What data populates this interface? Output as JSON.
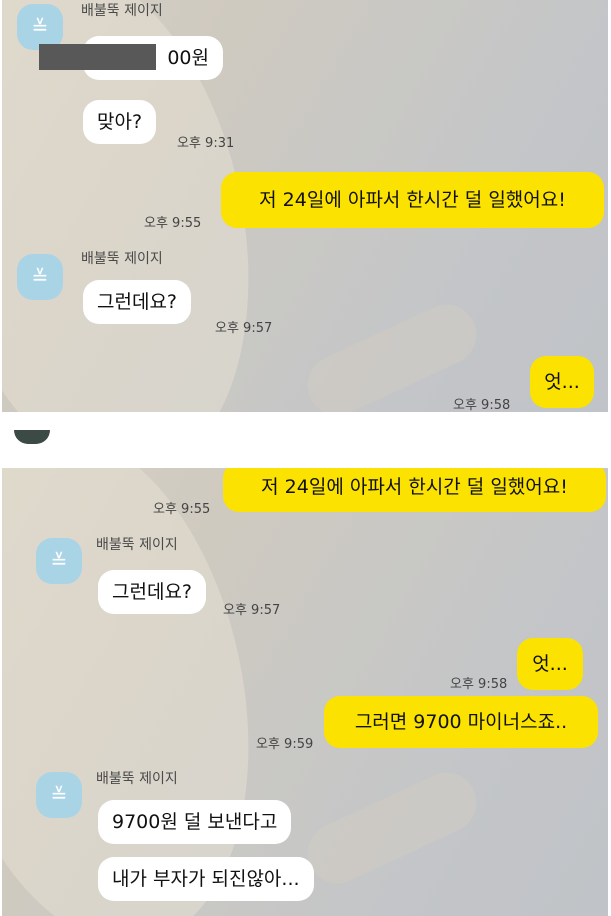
{
  "panel1": {
    "sender": "배불뚝 제이지",
    "msg_amount_suffix": "00원",
    "msg_right": "맞아?",
    "time_1": "오후 9:31",
    "my_msg_1": "저 24일에 아파서 한시간 덜 일했어요!",
    "time_2": "오후 9:55",
    "sender_2": "배불뚝 제이지",
    "msg_so": "그런데요?",
    "time_3": "오후 9:57",
    "my_msg_2": "엇...",
    "time_4": "오후 9:58"
  },
  "panel2": {
    "my_msg_1": "저 24일에 아파서 한시간 덜 일했어요!",
    "time_1": "오후 9:55",
    "sender_1": "배불뚝 제이지",
    "msg_so": "그런데요?",
    "time_2": "오후 9:57",
    "my_msg_2": "엇...",
    "time_3": "오후 9:58",
    "my_msg_3": "그러면 9700 마이너스죠..",
    "time_4": "오후 9:59",
    "sender_2": "배불뚝 제이지",
    "msg_a": "9700원 덜 보낸다고",
    "msg_b": "내가 부자가 되진않아..."
  },
  "colors": {
    "my_bubble": "#fbe200",
    "their_bubble": "#ffffff",
    "avatar": "#a9d4e6"
  },
  "icons": {
    "avatar": "profile-avatar-icon"
  }
}
